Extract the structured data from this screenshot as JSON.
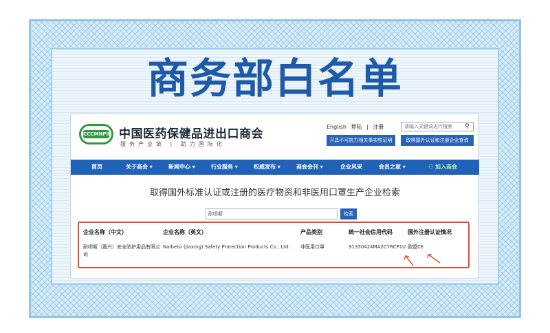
{
  "banner": {
    "title": "商务部白名单"
  },
  "header": {
    "logo_text": "CCCMHPIE",
    "org_name": "中国医药保健品进出口商会",
    "slogan": "服务产业链 | 助力国际化",
    "lang_english": "English",
    "login": "登陆",
    "separator": "|",
    "register": "注册",
    "search_placeholder": "请输入关键词进行搜索",
    "btn_cert_check": "开具不可抗力相关事实性证明",
    "btn_foreign_reg": "取得国外认证和注册企业查询"
  },
  "nav": {
    "items": [
      "首页",
      "关于商会 ▾",
      "新闻中心 ▾",
      "行业服务 ▾",
      "权威发布 ▾",
      "商会会刊 ▾",
      "企业风采",
      "会员之家 ▾"
    ],
    "join": "加入商会"
  },
  "main": {
    "heading": "取得国外标准认证或注册的医疗物资和非医用口罩生产企业检索",
    "query_value": "耐呗斯",
    "query_button": "检索"
  },
  "table": {
    "headers": [
      "企业名称（中文）",
      "企业名称（英文）",
      "产品类别",
      "统一社会信用代码",
      "国外注册认证情况"
    ],
    "rows": [
      {
        "name_cn": "耐呗斯（嘉兴）安全防护用品有限公司",
        "name_en": "Naibeisi (Jiaxing) Safety Protection Products Co., Ltd.",
        "category": "非医用口罩",
        "credit_code": "91330424MA2CYRCP1U",
        "certification": "欧盟CE"
      }
    ]
  },
  "colors": {
    "title_blue": "#1f5aa8",
    "nav_blue": "#1f62b7",
    "highlight_red": "#e84b2c",
    "logo_green": "#2b9a3c"
  }
}
